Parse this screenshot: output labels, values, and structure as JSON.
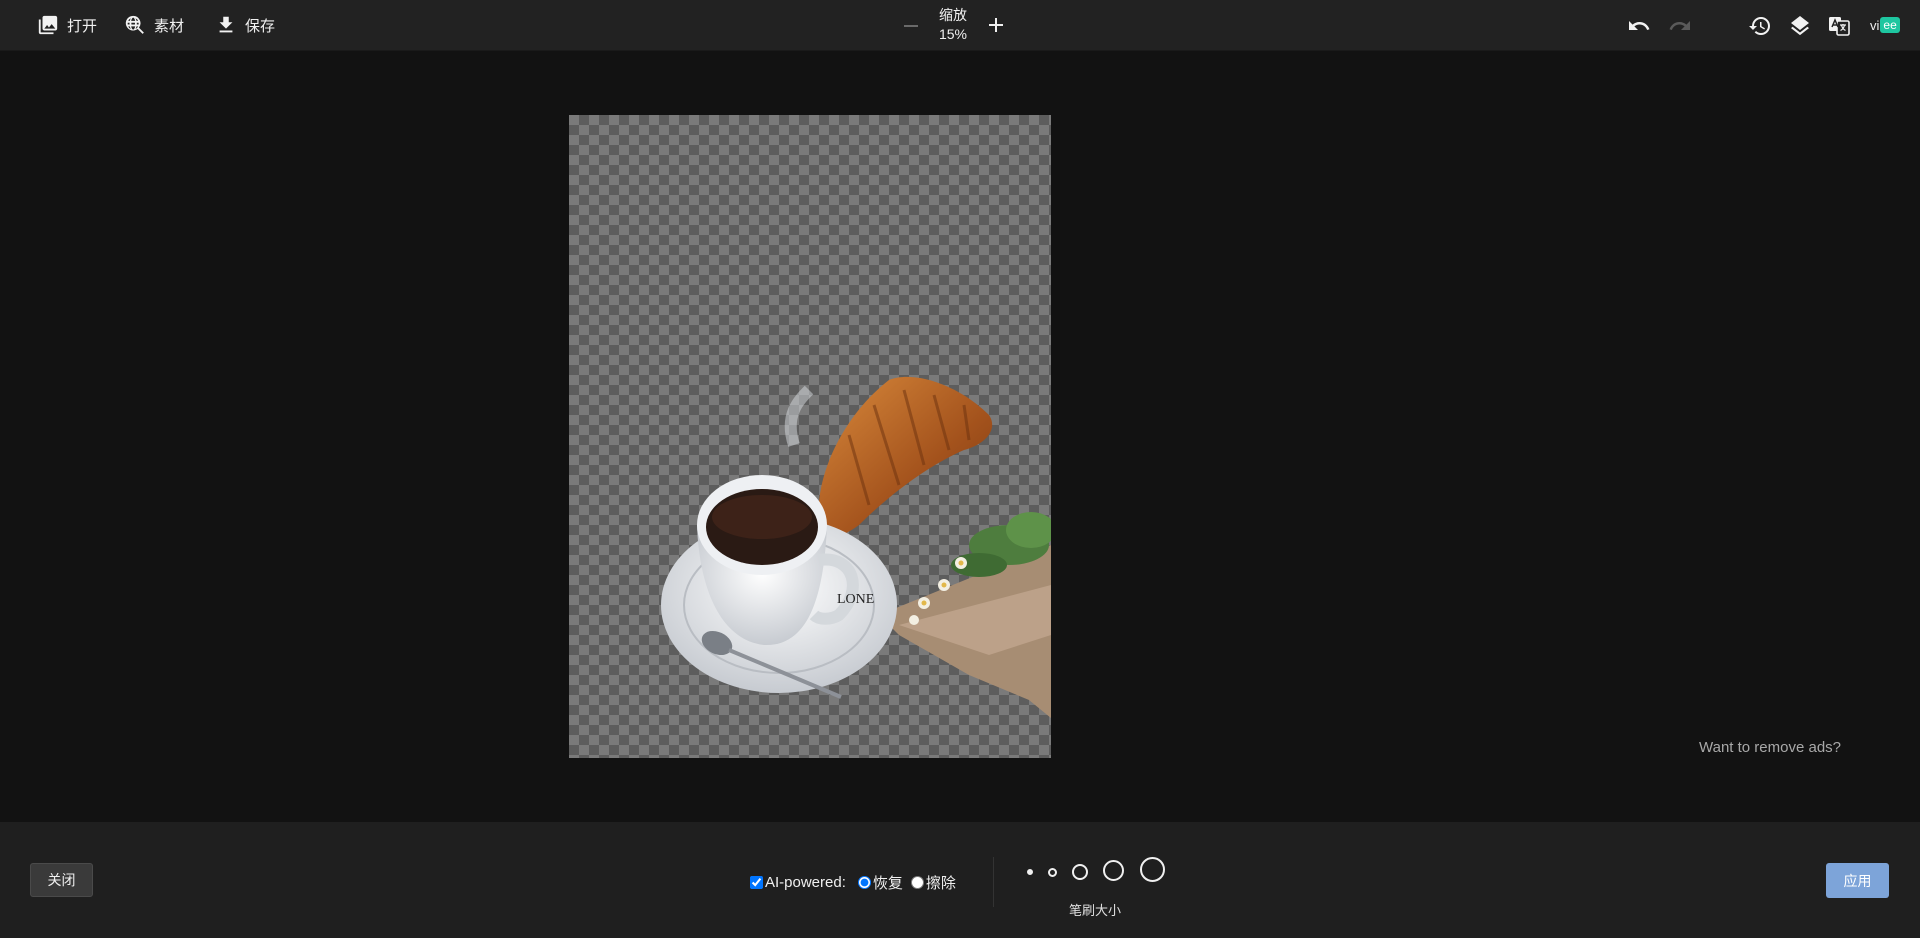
{
  "toolbar": {
    "open_label": "打开",
    "assets_label": "素材",
    "save_label": "保存",
    "zoom_title": "缩放",
    "zoom_value": "15%",
    "language_code": "vi",
    "language_badge": "ee",
    "icons": [
      "image-icon",
      "globe-search-icon",
      "download-icon",
      "undo-icon",
      "redo-icon",
      "history-icon",
      "layers-icon",
      "translate-icon"
    ]
  },
  "canvas": {
    "ads_text": "Want to remove ads?"
  },
  "bottom": {
    "close_label": "关闭",
    "ai_label": "AI-powered:",
    "ai_checked": true,
    "restore_label": "恢复",
    "erase_label": "擦除",
    "selected_mode": "restore",
    "brush_size_label": "笔刷大小",
    "brush_sizes": [
      "xs",
      "s",
      "m",
      "l",
      "xl"
    ],
    "apply_label": "应用"
  },
  "colors": {
    "accent": "#7da4d9",
    "badge": "#1ec6a0",
    "background": "#121212",
    "toolbar": "#222222"
  }
}
